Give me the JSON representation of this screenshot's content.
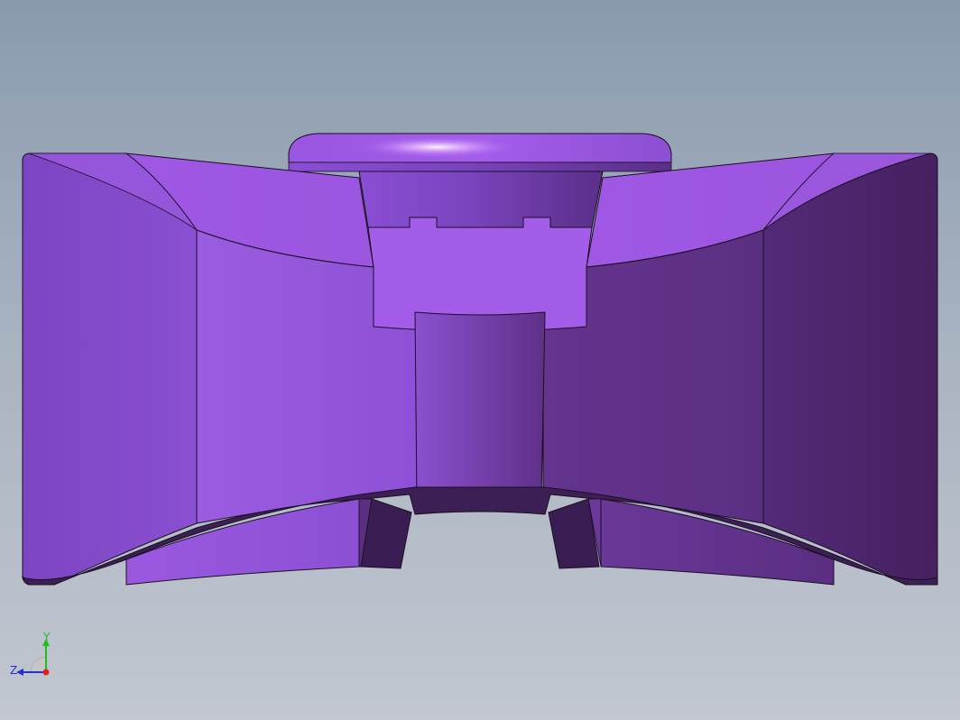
{
  "viewport": {
    "background_top": "#8a9aae",
    "background_bottom": "#c2c7d0"
  },
  "model": {
    "base_color": "#8e52d8",
    "light_color": "#a35ae6",
    "dark_color": "#4a2266",
    "edge_color": "#1a0f22"
  },
  "triad": {
    "y_label": "Y",
    "z_label": "Z",
    "y_color": "#22bb22",
    "z_color": "#2233cc",
    "x_color": "#dd2222"
  }
}
